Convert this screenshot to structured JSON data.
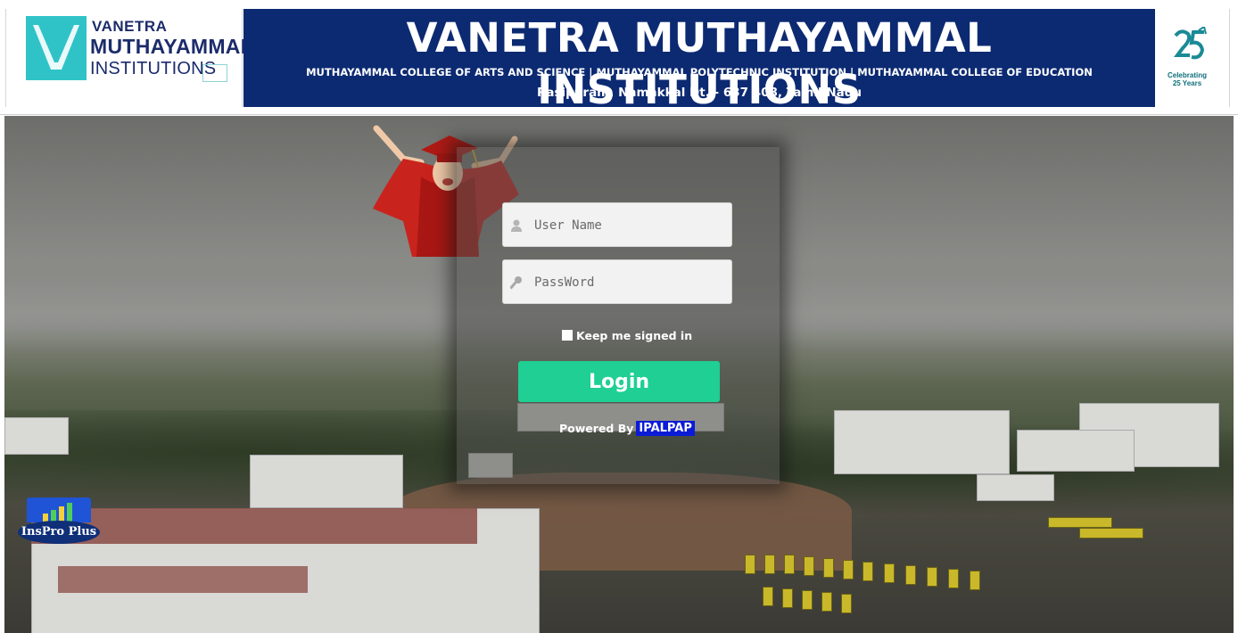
{
  "header": {
    "logo": {
      "line1": "VANETRA",
      "line2": "MUTHAYAMMAL",
      "line3": "INSTITUTIONS"
    },
    "banner": {
      "title": "VANETRA MUTHAYAMMAL INSTITUTIONS",
      "subtitle": "MUTHAYAMMAL COLLEGE OF ARTS AND SCIENCE  |  MUTHAYAMMAL POLYTECHNIC INSTITUTION  |  MUTHAYAMMAL COLLEGE OF EDUCATION",
      "address": "Rasipuram, Namakkal Dt. - 637 408, Tamil Nadu"
    },
    "badge": {
      "line1": "Celebrating",
      "line2": "25 Years"
    }
  },
  "login": {
    "username_placeholder": "User Name",
    "password_placeholder": "PassWord",
    "keep_signed_in": "Keep me signed in",
    "login_button": "Login",
    "powered_by": "Powered By",
    "powered_brand": "IPALPAP"
  },
  "inspro": {
    "label": "InsPro Plus"
  },
  "colors": {
    "banner_bg": "#0c2a72",
    "login_button": "#1fcf93",
    "brand_highlight": "#0b1bd6",
    "logo_teal": "#2fc3c8"
  },
  "icons": {
    "username": "user-icon",
    "password": "key-icon"
  }
}
